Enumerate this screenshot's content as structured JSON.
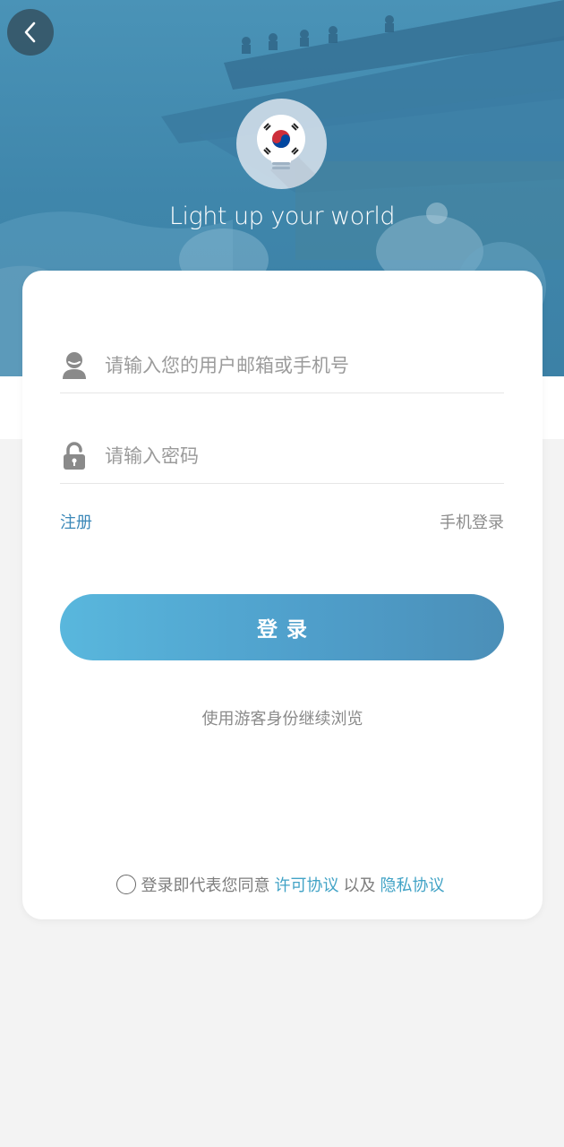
{
  "header": {
    "back_icon": "chevron-left-icon",
    "logo_icon": "lightbulb-korea-flag-icon",
    "slogan": "Light up your world"
  },
  "form": {
    "username_placeholder": "请输入您的用户邮箱或手机号",
    "username_icon": "user-icon",
    "password_placeholder": "请输入密码",
    "password_icon": "lock-icon",
    "register_link": "注册",
    "phone_login_link": "手机登录",
    "login_button": "登录",
    "guest_link": "使用游客身份继续浏览"
  },
  "agreement": {
    "prefix": "登录即代表您同意",
    "license_link": "许可协议",
    "conjunction": "以及",
    "privacy_link": "隐私协议"
  },
  "colors": {
    "hero": "#4a93b7",
    "accent": "#3b88b8",
    "link": "#42a3c6",
    "button_start": "#59b7dd",
    "button_end": "#4b8fb8",
    "page_bg": "#f3f3f3"
  }
}
